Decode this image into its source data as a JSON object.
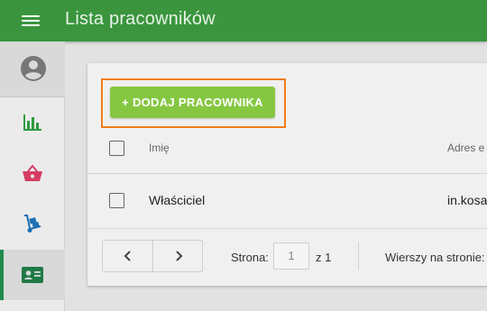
{
  "header": {
    "title": "Lista pracowników"
  },
  "toolbar": {
    "add_label": "+ DODAJ PRACOWNIKA"
  },
  "table": {
    "columns": [
      "Imię",
      "Adres e"
    ],
    "rows": [
      {
        "name": "Właściciel",
        "email": "in.kosa"
      }
    ]
  },
  "pagination": {
    "page_label": "Strona:",
    "page_value": "1",
    "of_label": "z 1",
    "rows_label": "Wierszy na stronie:"
  },
  "colors": {
    "header": "#3a953e",
    "add_button": "#86c742",
    "highlight": "#f07d1a",
    "active_indicator": "#1f8a4c"
  },
  "sidebar": {
    "items": [
      {
        "icon": "account-circle-icon"
      },
      {
        "icon": "bar-chart-icon"
      },
      {
        "icon": "shopping-basket-icon"
      },
      {
        "icon": "hand-truck-icon"
      },
      {
        "icon": "contact-card-icon",
        "active": true
      }
    ]
  }
}
